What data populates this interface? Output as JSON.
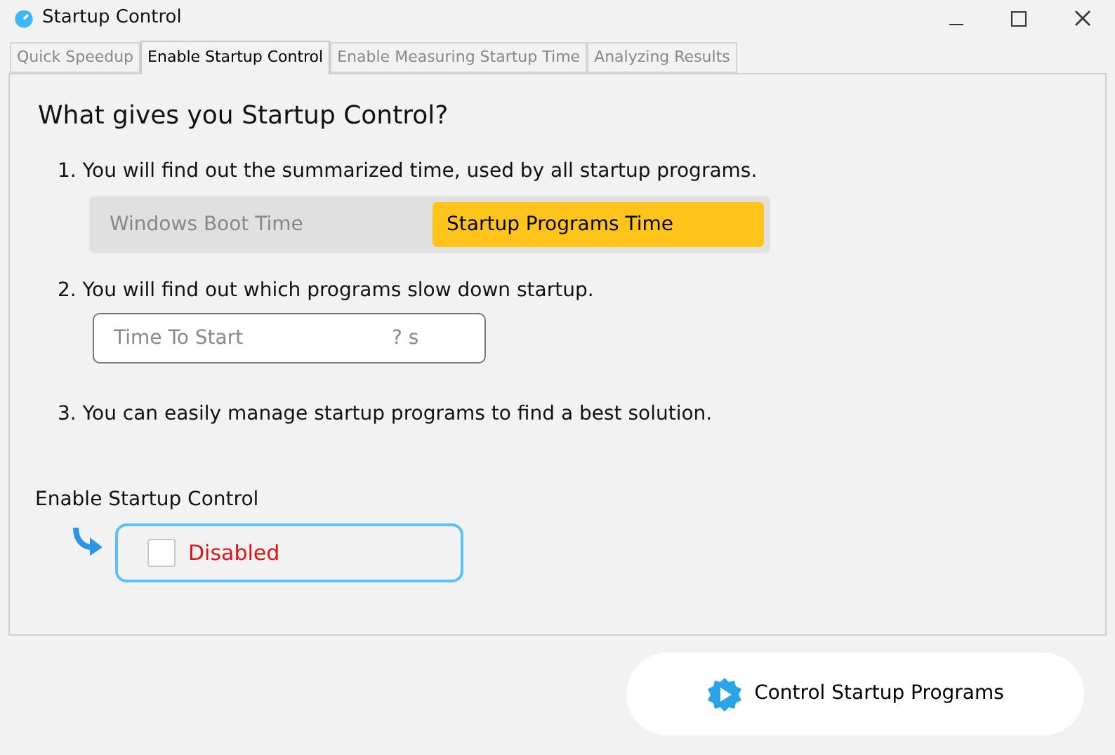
{
  "window": {
    "title": "Startup Control"
  },
  "tabs": [
    {
      "label": "Quick Speedup",
      "selected": false
    },
    {
      "label": "Enable Startup Control",
      "selected": true
    },
    {
      "label": "Enable Measuring Startup Time",
      "selected": false
    },
    {
      "label": "Analyzing Results",
      "selected": false
    }
  ],
  "heading": "What gives you Startup Control?",
  "points": [
    {
      "text": "1. You will find out the summarized time, used by all startup programs."
    },
    {
      "text": "2. You will find out which programs slow down startup."
    },
    {
      "text": "3. You can easily manage startup programs to find a best solution."
    }
  ],
  "time_toggle": [
    {
      "label": "Windows Boot Time",
      "selected": false
    },
    {
      "label": "Startup Programs Time",
      "selected": true
    }
  ],
  "time_field": {
    "label": "Time To Start",
    "value": "? s"
  },
  "enable": {
    "label": "Enable Startup Control",
    "checked": false,
    "status": "Disabled"
  },
  "action_button": {
    "label": "Control Startup Programs"
  }
}
